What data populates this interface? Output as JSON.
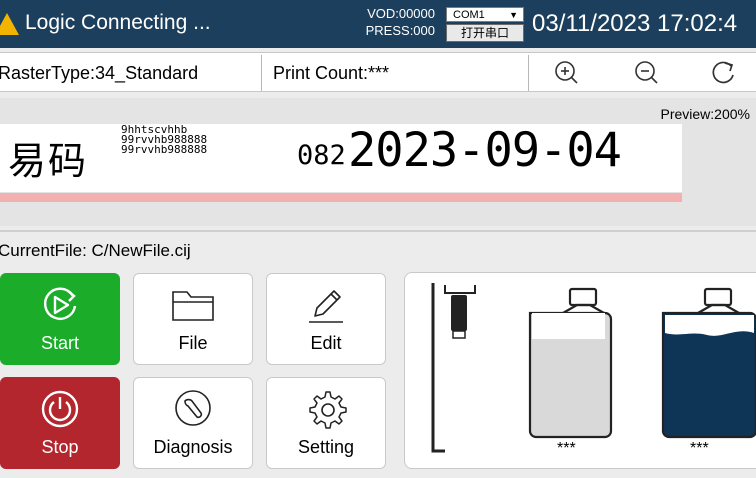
{
  "titlebar": {
    "status_text": "Logic Connecting ...",
    "vod": "VOD:00000",
    "press": "PRESS:000",
    "port_select": "COM1",
    "open_port_label": "打开串口",
    "datetime": "03/11/2023 17:02:4"
  },
  "infobar": {
    "raster_type": "RasterType:34_Standard",
    "print_count": "Print Count:***"
  },
  "preview": {
    "zoom_label": "Preview:200%",
    "cn_text": "易码",
    "line1": "9hhtscvhhb",
    "line2": "99rvvhb988888",
    "line3": "99rvvhb988888",
    "number_small": "082",
    "date_big": "2023-09-04"
  },
  "current_file": "CurrentFile: C/NewFile.cij",
  "buttons": {
    "start": "Start",
    "stop": "Stop",
    "file": "File",
    "edit": "Edit",
    "diagnosis": "Diagnosis",
    "setting": "Setting"
  },
  "ink": {
    "bottle1_level": "***",
    "bottle2_level": "***"
  },
  "colors": {
    "titlebar": "#1b3f5c",
    "start": "#1bac2a",
    "stop": "#b3262d",
    "preview_bar": "#f3b0b0"
  }
}
